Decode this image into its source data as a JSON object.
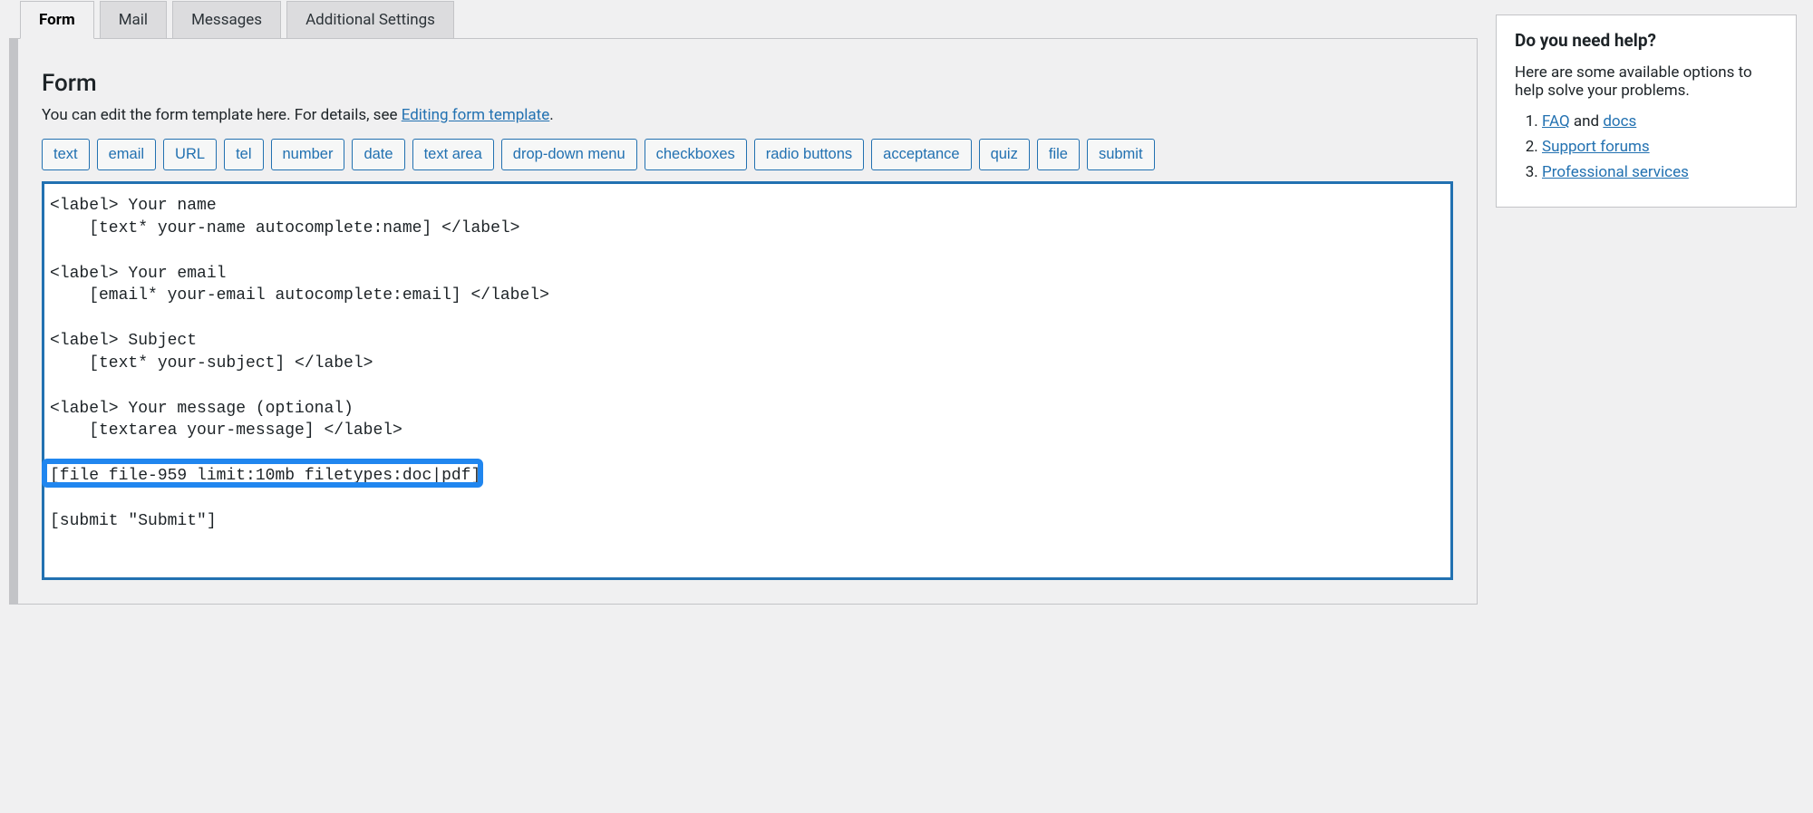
{
  "tabs": [
    {
      "label": "Form",
      "active": true
    },
    {
      "label": "Mail",
      "active": false
    },
    {
      "label": "Messages",
      "active": false
    },
    {
      "label": "Additional Settings",
      "active": false
    }
  ],
  "panel": {
    "heading": "Form",
    "desc_prefix": "You can edit the form template here. For details, see ",
    "desc_link": "Editing form template",
    "desc_suffix": "."
  },
  "tag_buttons": [
    "text",
    "email",
    "URL",
    "tel",
    "number",
    "date",
    "text area",
    "drop-down menu",
    "checkboxes",
    "radio buttons",
    "acceptance",
    "quiz",
    "file",
    "submit"
  ],
  "code_lines": [
    "<label> Your name",
    "    [text* your-name autocomplete:name] </label>",
    "",
    "<label> Your email",
    "    [email* your-email autocomplete:email] </label>",
    "",
    "<label> Subject",
    "    [text* your-subject] </label>",
    "",
    "<label> Your message (optional)",
    "    [textarea your-message] </label>",
    "",
    "[file file-959 limit:10mb filetypes:doc|pdf]",
    "",
    "[submit \"Submit\"]"
  ],
  "highlight_line_index": 12,
  "help": {
    "title": "Do you need help?",
    "intro": "Here are some available options to help solve your problems.",
    "items": [
      {
        "prefix_link": "FAQ",
        "suffix_text": " and ",
        "suffix_link": "docs"
      },
      {
        "prefix_link": "Support forums",
        "suffix_text": "",
        "suffix_link": ""
      },
      {
        "prefix_link": "Professional services",
        "suffix_text": "",
        "suffix_link": ""
      }
    ]
  }
}
